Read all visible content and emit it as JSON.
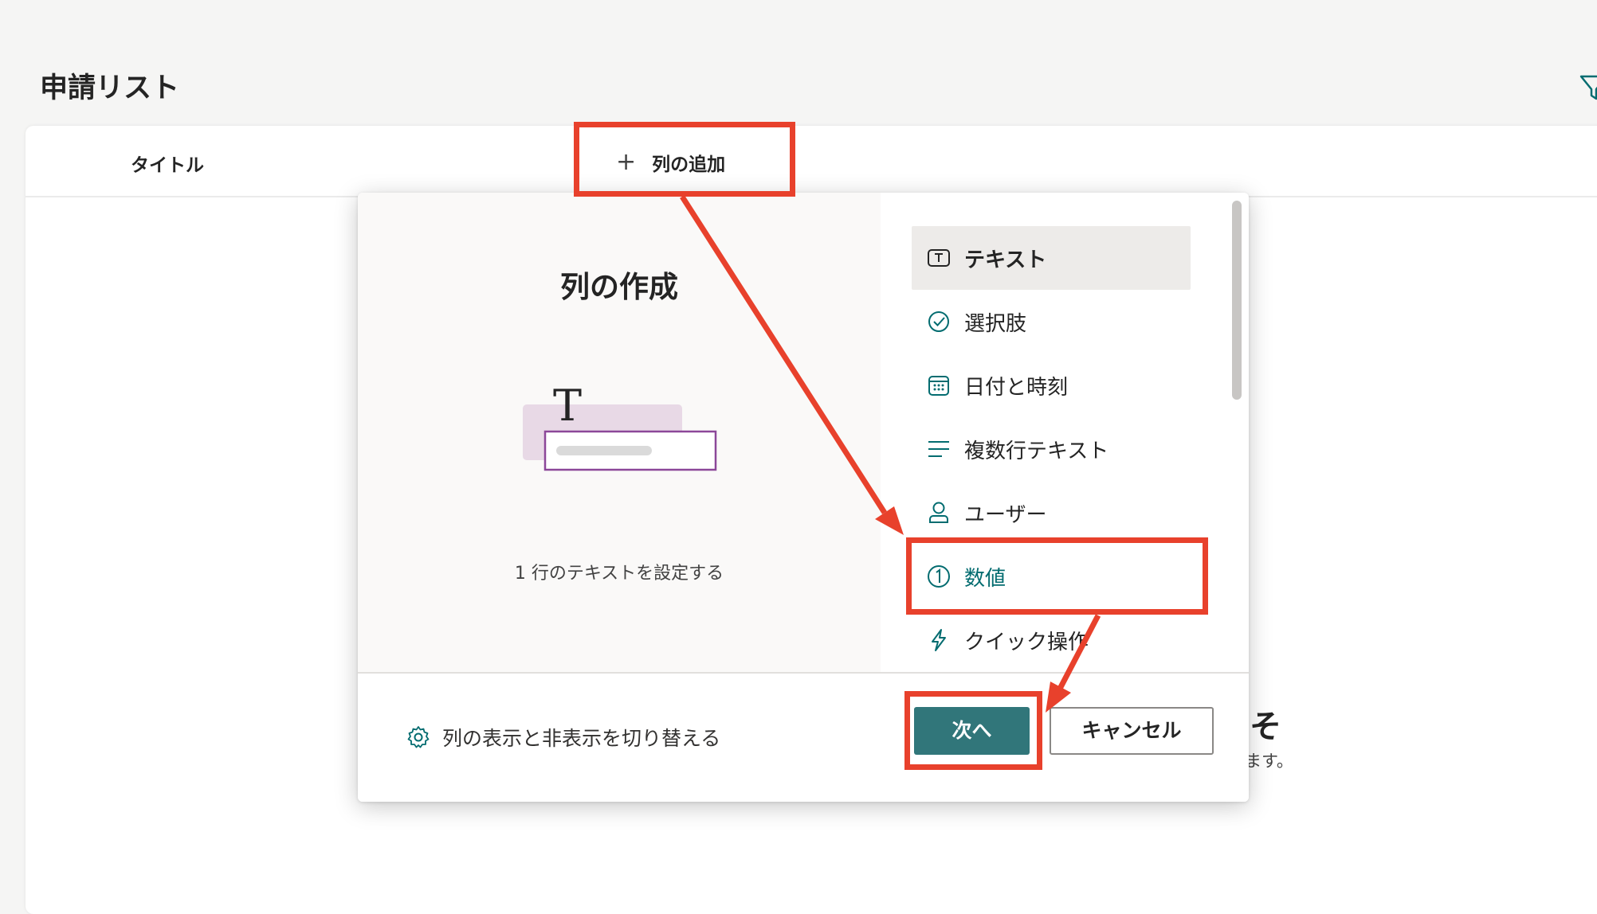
{
  "page": {
    "title": "申請リスト"
  },
  "list": {
    "columns": [
      "タイトル"
    ],
    "add_column_label": "列の追加",
    "empty_heading": "そ",
    "empty_sub": "ます。"
  },
  "dialog": {
    "title": "列の作成",
    "preview_description": "1 行のテキストを設定する",
    "types": [
      {
        "label": "テキスト",
        "icon": "text-icon",
        "state": "selected"
      },
      {
        "label": "選択肢",
        "icon": "choice-check-icon"
      },
      {
        "label": "日付と時刻",
        "icon": "calendar-icon"
      },
      {
        "label": "複数行テキスト",
        "icon": "multiline-icon"
      },
      {
        "label": "ユーザー",
        "icon": "person-icon"
      },
      {
        "label": "数値",
        "icon": "number-icon",
        "state": "annotated"
      },
      {
        "label": "クイック操作",
        "icon": "lightning-icon"
      }
    ],
    "footer": {
      "toggle_label": "列の表示と非表示を切り替える",
      "next_label": "次へ",
      "cancel_label": "キャンセル"
    }
  },
  "colors": {
    "accent": "#31767a",
    "accent_text": "#036c70",
    "annotation": "#e8412c",
    "preview_purple": "#8c4799",
    "preview_bg": "#e8d9e6"
  }
}
